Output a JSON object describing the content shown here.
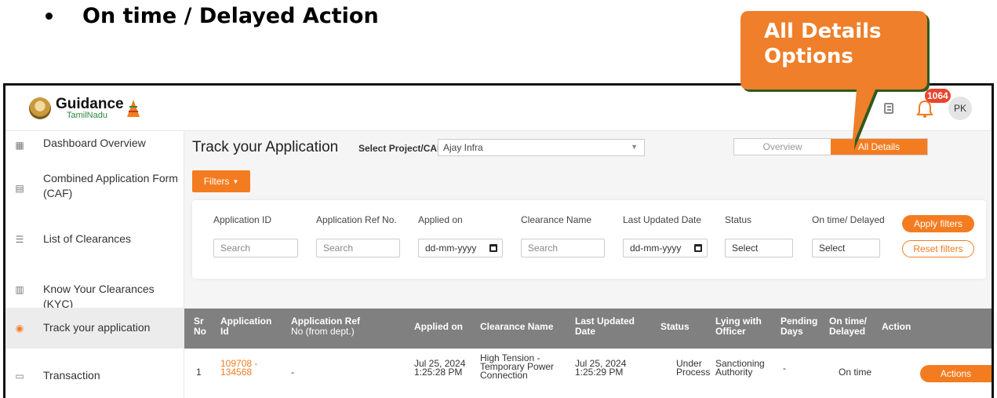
{
  "slide": {
    "title": "On time / Delayed Action"
  },
  "callout": {
    "text": "All Details Options"
  },
  "header": {
    "logo_main": "Guidance",
    "logo_sub": "TamilNadu",
    "notification_count": "1064",
    "avatar_initials": "PK"
  },
  "sidebar": {
    "items": [
      {
        "label": "Dashboard Overview"
      },
      {
        "label": "Combined Application Form (CAF)"
      },
      {
        "label": "List of Clearances"
      },
      {
        "label": "Know Your Clearances (KYC)"
      },
      {
        "label": "Track your application"
      },
      {
        "label": "Transaction"
      }
    ]
  },
  "main": {
    "heading": "Track your Application",
    "select_label": "Select Project/CAF",
    "select_value": "Ajay Infra",
    "toggle": {
      "overview": "Overview",
      "all_details": "All Details"
    },
    "filters_button": "Filters"
  },
  "filters": {
    "labels": [
      "Application ID",
      "Application Ref No.",
      "Applied on",
      "Clearance Name",
      "Last Updated Date",
      "Status",
      "On time/ Delayed"
    ],
    "app_id_placeholder": "Search",
    "app_ref_placeholder": "Search",
    "applied_on": "dd-mm-yyyy",
    "clearance_placeholder": "Search",
    "last_updated": "dd-mm-yyyy",
    "status": "Select",
    "ontime": "Select",
    "apply": "Apply filters",
    "reset": "Reset filters"
  },
  "table": {
    "headers": {
      "sr": [
        "Sr",
        "No"
      ],
      "app_id": [
        "Application",
        "Id"
      ],
      "app_ref": [
        "Application Ref",
        "No (from dept.)"
      ],
      "applied": [
        "Applied on"
      ],
      "clearance": [
        "Clearance Name"
      ],
      "last_updated": [
        "Last Updated",
        "Date"
      ],
      "status": [
        "Status"
      ],
      "lying": [
        "Lying with",
        "Officer"
      ],
      "pending": [
        "Pending",
        "Days"
      ],
      "ontime": [
        "On time/",
        "Delayed"
      ],
      "action": [
        "Action"
      ]
    },
    "rows": [
      {
        "sr": "1",
        "app_id": [
          "109708 -",
          "134568"
        ],
        "app_ref": "-",
        "applied": [
          "Jul 25, 2024",
          "1:25:28 PM"
        ],
        "clearance": [
          "High Tension -",
          "Temporary Power",
          "Connection"
        ],
        "last_updated": [
          "Jul 25, 2024",
          "1:25:29 PM"
        ],
        "status": [
          "Under",
          "Process"
        ],
        "lying": [
          "Sanctioning",
          "Authority"
        ],
        "pending": "-",
        "ontime": "On time",
        "action": "Actions"
      }
    ]
  },
  "colors": {
    "accent": "#f47c20",
    "table_header": "#808080",
    "callout": "#ef7f2a"
  }
}
